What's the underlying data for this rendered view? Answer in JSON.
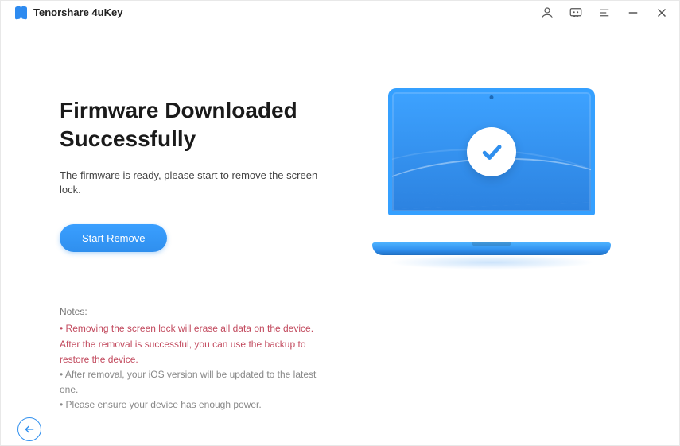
{
  "app": {
    "title": "Tenorshare 4uKey"
  },
  "titlebar_icons": {
    "account": "account-icon",
    "feedback": "feedback-icon",
    "menu": "menu-icon",
    "minimize": "minimize-icon",
    "close": "close-icon"
  },
  "main": {
    "heading": "Firmware Downloaded Successfully",
    "subtext": "The firmware is ready, please start to remove the screen lock.",
    "button_label": "Start Remove"
  },
  "notes": {
    "heading": "Notes:",
    "warning": "• Removing the screen lock will erase all data on the device. After the removal is successful, you can use the backup to restore the device.",
    "line2": "• After removal, your iOS version will be updated to the latest one.",
    "line3": "• Please ensure your device has enough power."
  },
  "illustration": {
    "name": "laptop-check-illustration"
  },
  "footer": {
    "back": "back-button"
  },
  "colors": {
    "primary": "#2f8fee",
    "warning_text": "#c24a5e"
  }
}
